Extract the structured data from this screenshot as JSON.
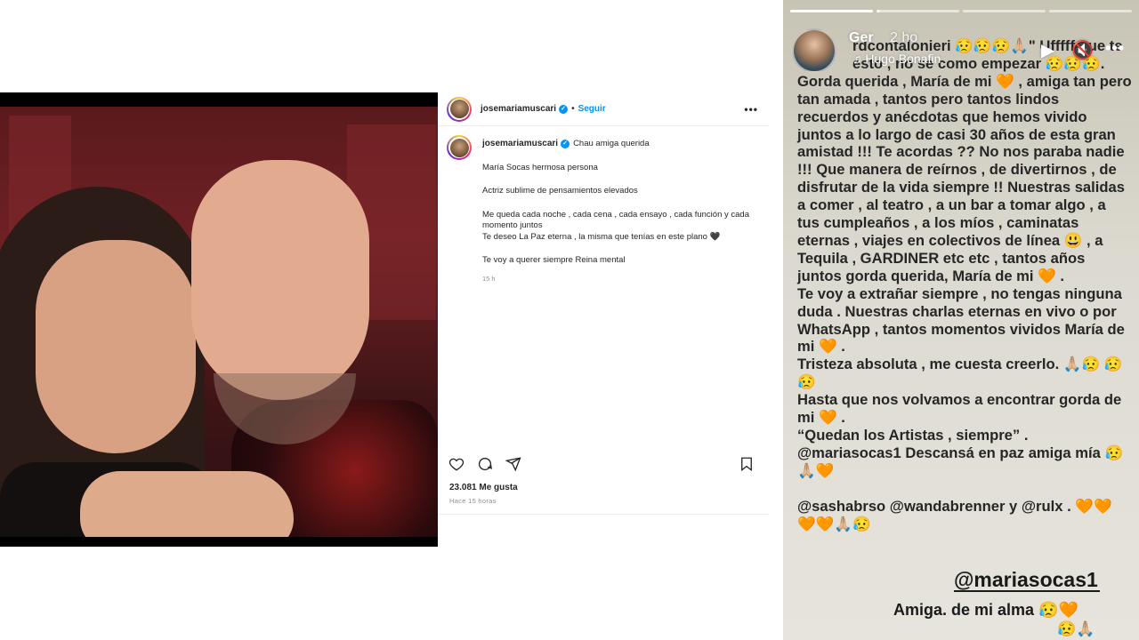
{
  "post": {
    "username": "josemariamuscari",
    "verified_badge": "✓",
    "separator": "•",
    "follow_label": "Seguir",
    "more_label": "•••",
    "caption": {
      "first_line": "Chau amiga querida",
      "lines": [
        "María Socas hermosa persona",
        "Actriz sublime de pensamientos elevados",
        "Me queda cada noche , cada cena , cada ensayo , cada función y cada momento juntos",
        "Te deseo La Paz eterna , la misma que tenías en este plano 🖤",
        "Te voy a querer siempre Reina mental"
      ],
      "time": "15 h"
    },
    "likes": "23.081 Me gusta",
    "posted_ago": "Hace 15 horas",
    "icons": [
      "heart-icon",
      "comment-icon",
      "share-icon",
      "bookmark-icon"
    ]
  },
  "story": {
    "progress_segments": 4,
    "progress_done": 1,
    "author_short": "Ger",
    "time": "2 ho",
    "music": "♫ Hugo Bonafin",
    "play_icon": "▶",
    "mute_icon": "🔇",
    "more_label": "•••",
    "paragraphs": [
      "rdcontalonieri 😥😥😥🙏🏼\" Ufffff que te esto , no se como empezar 😥😥😥.",
      "Gorda querida , María de mi 🧡 , amiga tan pero tan amada , tantos pero tantos lindos recuerdos y anécdotas que hemos vivido juntos a lo largo de  casi 30 años de esta gran amistad !!! Te acordas ?? No nos paraba nadie !!! Que manera de reírnos , de divertirnos , de disfrutar de la vida siempre !! Nuestras salidas a comer , al teatro , a un bar a tomar algo , a tus cumpleaños , a los míos , caminatas eternas , viajes en colectivos de línea 😃 , a Tequila , GARDINER etc etc , tantos años juntos gorda querida, María de mi 🧡 .",
      "Te voy a extrañar siempre , no tengas ninguna duda . Nuestras charlas eternas en vivo o por WhatsApp , tantos momentos vividos María de mi 🧡 .",
      "Tristeza absoluta , me cuesta creerlo. 🙏🏼😥 😥😥",
      "Hasta que nos volvamos a encontrar gorda de mi 🧡 .",
      "“Quedan los Artistas , siempre” .",
      "@mariasocas1  Descansá en paz amiga mía 😥🙏🏼🧡"
    ],
    "mentions_line": "@sashabrso @wandabrenner y @rulx . 🧡🧡 🧡🧡🙏🏼😥",
    "mention_sticker": "@mariasocas1",
    "closing_line": "Amiga. de mi alma 😥🧡",
    "bottom_emojis": "😥🙏🏼"
  },
  "colors": {
    "link_blue": "#0095f6",
    "text_dark": "#262626",
    "muted": "#8e8e8e",
    "story_bg": "#dcdad0"
  }
}
